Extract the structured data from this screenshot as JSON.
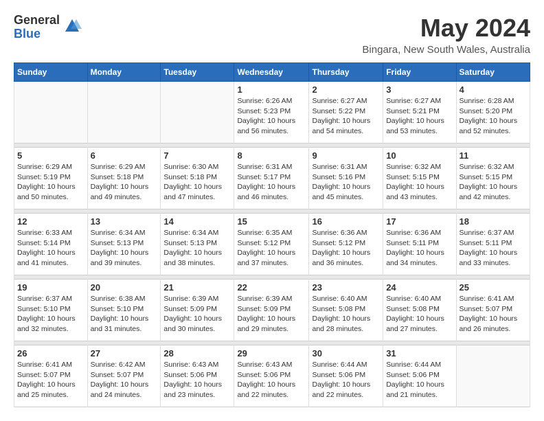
{
  "logo": {
    "general": "General",
    "blue": "Blue"
  },
  "title": "May 2024",
  "location": "Bingara, New South Wales, Australia",
  "headers": [
    "Sunday",
    "Monday",
    "Tuesday",
    "Wednesday",
    "Thursday",
    "Friday",
    "Saturday"
  ],
  "weeks": [
    [
      {
        "day": "",
        "info": ""
      },
      {
        "day": "",
        "info": ""
      },
      {
        "day": "",
        "info": ""
      },
      {
        "day": "1",
        "info": "Sunrise: 6:26 AM\nSunset: 5:23 PM\nDaylight: 10 hours\nand 56 minutes."
      },
      {
        "day": "2",
        "info": "Sunrise: 6:27 AM\nSunset: 5:22 PM\nDaylight: 10 hours\nand 54 minutes."
      },
      {
        "day": "3",
        "info": "Sunrise: 6:27 AM\nSunset: 5:21 PM\nDaylight: 10 hours\nand 53 minutes."
      },
      {
        "day": "4",
        "info": "Sunrise: 6:28 AM\nSunset: 5:20 PM\nDaylight: 10 hours\nand 52 minutes."
      }
    ],
    [
      {
        "day": "5",
        "info": "Sunrise: 6:29 AM\nSunset: 5:19 PM\nDaylight: 10 hours\nand 50 minutes."
      },
      {
        "day": "6",
        "info": "Sunrise: 6:29 AM\nSunset: 5:18 PM\nDaylight: 10 hours\nand 49 minutes."
      },
      {
        "day": "7",
        "info": "Sunrise: 6:30 AM\nSunset: 5:18 PM\nDaylight: 10 hours\nand 47 minutes."
      },
      {
        "day": "8",
        "info": "Sunrise: 6:31 AM\nSunset: 5:17 PM\nDaylight: 10 hours\nand 46 minutes."
      },
      {
        "day": "9",
        "info": "Sunrise: 6:31 AM\nSunset: 5:16 PM\nDaylight: 10 hours\nand 45 minutes."
      },
      {
        "day": "10",
        "info": "Sunrise: 6:32 AM\nSunset: 5:15 PM\nDaylight: 10 hours\nand 43 minutes."
      },
      {
        "day": "11",
        "info": "Sunrise: 6:32 AM\nSunset: 5:15 PM\nDaylight: 10 hours\nand 42 minutes."
      }
    ],
    [
      {
        "day": "12",
        "info": "Sunrise: 6:33 AM\nSunset: 5:14 PM\nDaylight: 10 hours\nand 41 minutes."
      },
      {
        "day": "13",
        "info": "Sunrise: 6:34 AM\nSunset: 5:13 PM\nDaylight: 10 hours\nand 39 minutes."
      },
      {
        "day": "14",
        "info": "Sunrise: 6:34 AM\nSunset: 5:13 PM\nDaylight: 10 hours\nand 38 minutes."
      },
      {
        "day": "15",
        "info": "Sunrise: 6:35 AM\nSunset: 5:12 PM\nDaylight: 10 hours\nand 37 minutes."
      },
      {
        "day": "16",
        "info": "Sunrise: 6:36 AM\nSunset: 5:12 PM\nDaylight: 10 hours\nand 36 minutes."
      },
      {
        "day": "17",
        "info": "Sunrise: 6:36 AM\nSunset: 5:11 PM\nDaylight: 10 hours\nand 34 minutes."
      },
      {
        "day": "18",
        "info": "Sunrise: 6:37 AM\nSunset: 5:11 PM\nDaylight: 10 hours\nand 33 minutes."
      }
    ],
    [
      {
        "day": "19",
        "info": "Sunrise: 6:37 AM\nSunset: 5:10 PM\nDaylight: 10 hours\nand 32 minutes."
      },
      {
        "day": "20",
        "info": "Sunrise: 6:38 AM\nSunset: 5:10 PM\nDaylight: 10 hours\nand 31 minutes."
      },
      {
        "day": "21",
        "info": "Sunrise: 6:39 AM\nSunset: 5:09 PM\nDaylight: 10 hours\nand 30 minutes."
      },
      {
        "day": "22",
        "info": "Sunrise: 6:39 AM\nSunset: 5:09 PM\nDaylight: 10 hours\nand 29 minutes."
      },
      {
        "day": "23",
        "info": "Sunrise: 6:40 AM\nSunset: 5:08 PM\nDaylight: 10 hours\nand 28 minutes."
      },
      {
        "day": "24",
        "info": "Sunrise: 6:40 AM\nSunset: 5:08 PM\nDaylight: 10 hours\nand 27 minutes."
      },
      {
        "day": "25",
        "info": "Sunrise: 6:41 AM\nSunset: 5:07 PM\nDaylight: 10 hours\nand 26 minutes."
      }
    ],
    [
      {
        "day": "26",
        "info": "Sunrise: 6:41 AM\nSunset: 5:07 PM\nDaylight: 10 hours\nand 25 minutes."
      },
      {
        "day": "27",
        "info": "Sunrise: 6:42 AM\nSunset: 5:07 PM\nDaylight: 10 hours\nand 24 minutes."
      },
      {
        "day": "28",
        "info": "Sunrise: 6:43 AM\nSunset: 5:06 PM\nDaylight: 10 hours\nand 23 minutes."
      },
      {
        "day": "29",
        "info": "Sunrise: 6:43 AM\nSunset: 5:06 PM\nDaylight: 10 hours\nand 22 minutes."
      },
      {
        "day": "30",
        "info": "Sunrise: 6:44 AM\nSunset: 5:06 PM\nDaylight: 10 hours\nand 22 minutes."
      },
      {
        "day": "31",
        "info": "Sunrise: 6:44 AM\nSunset: 5:06 PM\nDaylight: 10 hours\nand 21 minutes."
      },
      {
        "day": "",
        "info": ""
      }
    ]
  ]
}
